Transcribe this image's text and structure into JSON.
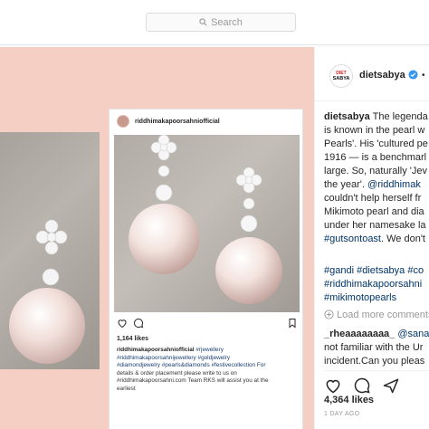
{
  "search": {
    "placeholder": "Search"
  },
  "post": {
    "account": {
      "username": "dietsabya",
      "logo_line1": "DIET",
      "logo_line2": "SABYA",
      "more_label": "•"
    },
    "caption_lines": [
      {
        "user": "dietsabya",
        "text": " The legenda"
      },
      {
        "text": "is known in the pearl w"
      },
      {
        "text": "Pearls'. His 'cultured pe"
      },
      {
        "text": "1916 — is a benchmarl"
      },
      {
        "text": "large. So, naturally 'Jev"
      },
      {
        "text": "the year'. ",
        "link": "@riddhimak"
      },
      {
        "text": "couldn't help herself fr"
      },
      {
        "text": "Mikimoto pearl and dia"
      },
      {
        "text": "under her namesake la"
      },
      {
        "link": "#gutsontoast",
        "text": ". We don't"
      }
    ],
    "hashtag_lines": [
      "#gandi #dietsabya #co",
      "#riddhimakapoorsahni",
      "#mikimotopearls"
    ],
    "load_more_label": "Load more comments",
    "comment": {
      "user": "_rheaaaaaaaa_",
      "link": "@sana",
      "line2": "not familiar with the Ur",
      "line3": "incident.Can you pleas"
    },
    "likes": "4,364 likes",
    "ago": "1 DAY AGO"
  },
  "embedded_post": {
    "username": "riddhimakapoorsahniofficial",
    "likes": "1,164 likes",
    "caption_user": "riddhimakapoorsahniofficial",
    "caption_tags1": " #rjewellery",
    "caption_line2": "#riddhimakapoorsahnijewellery #goldjewelry",
    "caption_line3": "#diamondjewelry #pearls&diamonds #festivecollection For",
    "caption_line4": "details & order placement please write to us on",
    "caption_line5": "#riddhimakapoorsahni.com Team RKS will assist you at the",
    "caption_line6": "earliest"
  },
  "colors": {
    "background_pink": "#f6cfc4",
    "link_blue": "#003569",
    "verified_blue": "#3897f0",
    "logo_red": "#d21f26"
  },
  "icons": [
    "search-icon",
    "verified-badge-icon",
    "heart-icon",
    "comment-icon",
    "share-icon",
    "bookmark-icon",
    "load-more-plus-icon"
  ]
}
